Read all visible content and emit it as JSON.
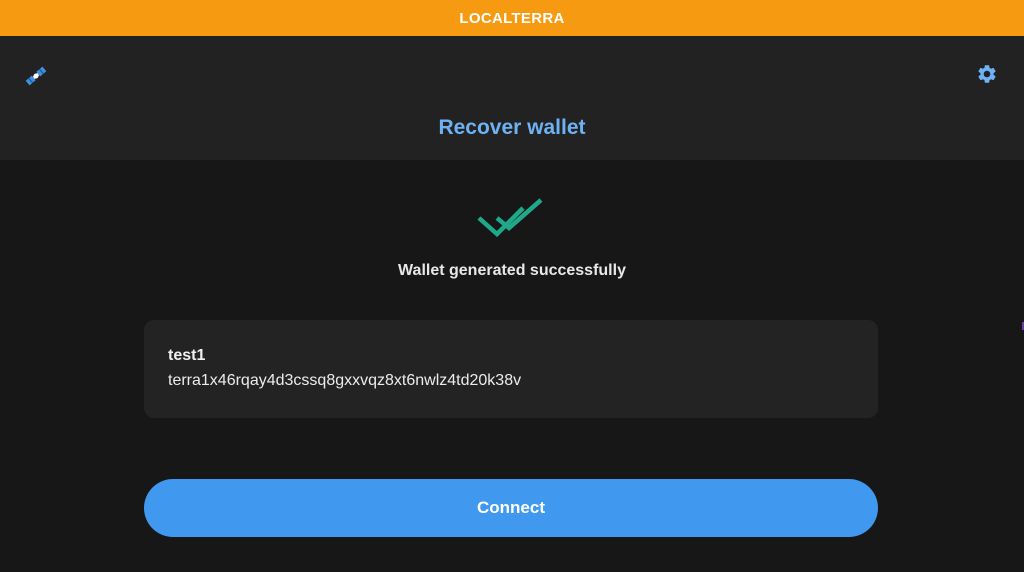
{
  "banner": {
    "network_label": "LOCALTERRA"
  },
  "header": {
    "left_icon": "satellite-icon",
    "right_icon": "gear-icon",
    "title": "Recover wallet"
  },
  "status": {
    "icon": "double-check-icon",
    "message": "Wallet generated successfully"
  },
  "wallet": {
    "name": "test1",
    "address": "terra1x46rqay4d3cssq8gxxvqz8xt6nwlz4td20k38v"
  },
  "actions": {
    "connect_label": "Connect"
  },
  "colors": {
    "banner": "#f69a11",
    "title": "#6fb2f3",
    "success": "#1fa98a",
    "button": "#4099ee"
  }
}
